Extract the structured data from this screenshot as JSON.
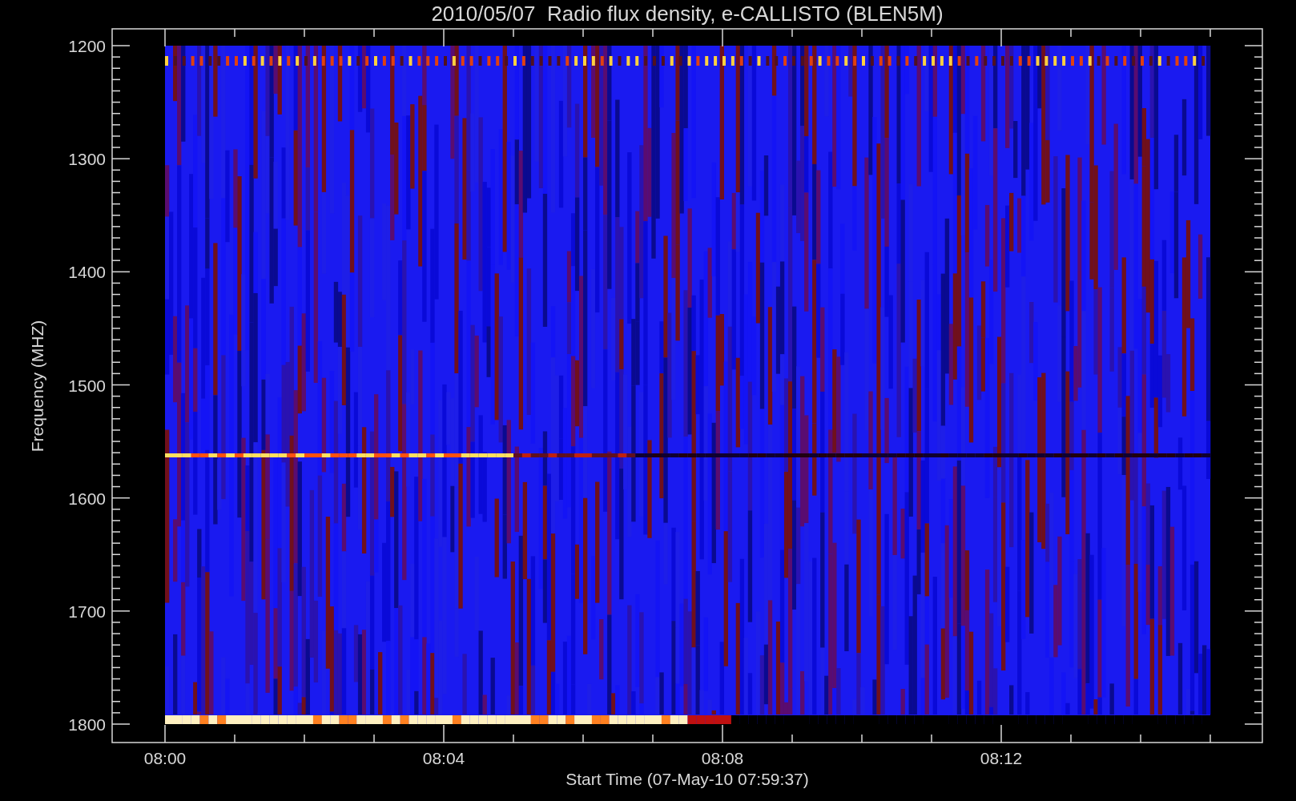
{
  "plot": {
    "title": "2010/05/07  Radio flux density, e-CALLISTO (BLEN5M)",
    "xlabel": "Start Time (07-May-10 07:59:37)",
    "ylabel": "Frequency (MHZ)",
    "xticks": [
      "08:00",
      "08:04",
      "08:08",
      "08:12"
    ],
    "yticks": [
      "1200",
      "1300",
      "1400",
      "1500",
      "1600",
      "1700",
      "1800"
    ]
  }
}
